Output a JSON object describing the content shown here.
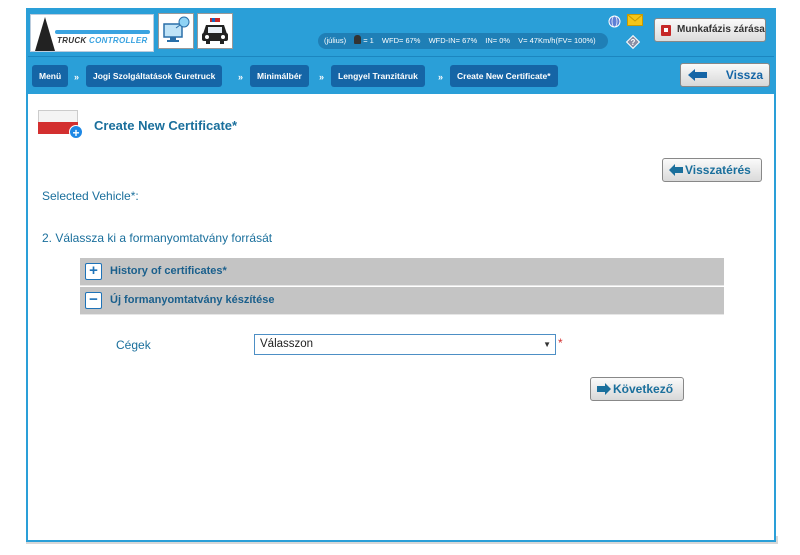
{
  "header": {
    "logo_text_a": "TRUCK",
    "logo_text_b": "CONTROLLER",
    "status": {
      "month": "(július)",
      "drivers": "= 1",
      "wfd": "WFD= 67%",
      "wfd_in": "WFD-IN= 67%",
      "in": "IN= 0%",
      "v": "V= 47Km/h(FV= 100%)"
    },
    "close_session_label": "Munkafázis zárása"
  },
  "breadcrumb": {
    "items": [
      "Menü",
      "Jogi Szolgáltatások Guretruck",
      "Minimálbér",
      "Lengyel Tranzitáruk",
      "Create New Certificate*"
    ],
    "separator": "»",
    "back_label": "Vissza"
  },
  "page": {
    "title": "Create New Certificate*",
    "return_label": "Visszatérés",
    "selected_vehicle_label": "Selected Vehicle*:",
    "step_label": "2. Válassza ki a formanyomtatvány forrását",
    "panels": [
      {
        "icon": "+",
        "title": "History of certificates*"
      },
      {
        "icon": "−",
        "title": "Új formanyomtatvány készítése"
      }
    ],
    "company_label": "Cégek",
    "company_select_value": "Válasszon",
    "required_mark": "*",
    "next_label": "Következő"
  },
  "colors": {
    "header_blue": "#2a9fd8",
    "crumb_blue": "#1565a6",
    "text_blue": "#1a6f9c",
    "panel_gray": "#c4c4c4",
    "flag_red": "#d32f2f"
  }
}
